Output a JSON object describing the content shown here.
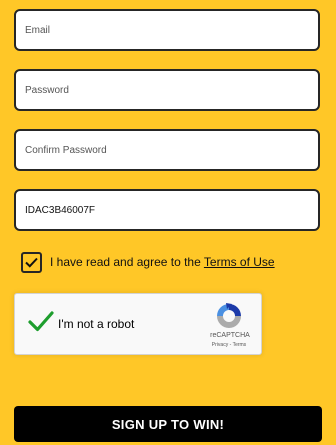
{
  "form": {
    "email": {
      "placeholder": "Email",
      "value": ""
    },
    "password": {
      "placeholder": "Password",
      "value": ""
    },
    "confirm_password": {
      "placeholder": "Confirm Password",
      "value": ""
    },
    "code": {
      "placeholder": "",
      "value": "IDAC3B46007F"
    },
    "terms": {
      "checked": true,
      "text": "I have read and agree to the ",
      "link_label": "Terms of Use"
    },
    "recaptcha": {
      "label": "I'm not a robot",
      "brand": "reCAPTCHA",
      "privacy": "Privacy",
      "separator": " - ",
      "terms": "Terms",
      "checked": true
    },
    "submit_label": "SIGN UP TO WIN!"
  },
  "colors": {
    "background": "#FFC727",
    "field_border": "#262626",
    "button": "#000000",
    "check_green": "#1E9E2E"
  },
  "icons": {
    "terms_check": "checkmark-icon",
    "recaptcha_check": "green-checkmark-icon",
    "recaptcha_logo": "recaptcha-logo-icon"
  }
}
